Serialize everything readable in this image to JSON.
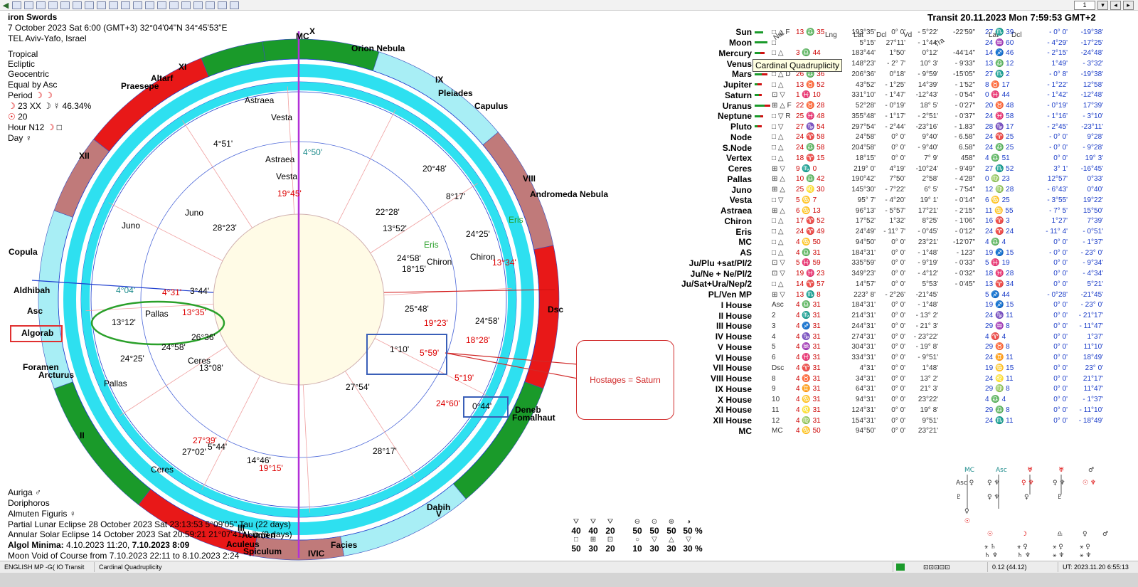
{
  "chart_header": {
    "name": "iron Swords",
    "date_line": "7 October 2023  Sat   6:00 (GMT+3) 32°04'04\"N  34°45'53\"E",
    "place": "TEL Aviv-Yafo, Israel",
    "settings": [
      "Tropical",
      "Ecliptic",
      "Geocentric",
      "Equal by Asc"
    ],
    "period": "Period",
    "period_line": "23 XX  ☽ ☿ 46.34%",
    "sun_line": "20",
    "hour": "Hour N12",
    "day": "Day"
  },
  "transit_header": "Transit 20.11.2023  Mon  7:59:53 GMT+2",
  "tooltip": "Cardinal Quadruplicity",
  "callout_text": "Hostages = Saturn",
  "fixed_stars_left": {
    "copula": "Copula",
    "aldhibah": "Aldhibah",
    "asc": "Asc",
    "algorab": "Algorab",
    "foramen": "Foramen",
    "arcturus": "Arcturus",
    "mc": "MC",
    "dsc": "Dsc",
    "ic": "IVIC"
  },
  "outer_stars": {
    "orion": "Orion Nebula",
    "pleiades": "Pleiades",
    "capulus": "Capulus",
    "andromeda": "Andromeda Nebula",
    "praesepe": "Praesepe",
    "altarf": "Altarf",
    "deneb": "Deneb",
    "fomalhaut": "Fomalhaut",
    "dabih": "Dabih",
    "facies": "Facies",
    "aculeus": "Aculeus",
    "acumen": "Acumen",
    "spiculum": "Spiculum"
  },
  "houses": [
    "XI",
    "XII",
    "IX",
    "VIII",
    "II",
    "III",
    "V",
    "X"
  ],
  "chart_labels": {
    "astraea_outer": "Astraea",
    "vesta_outer": "Vesta",
    "astraea_inner": "Astraea",
    "vesta_inner": "Vesta",
    "juno_outer": "Juno",
    "juno_inner": "Juno",
    "pallas_inner": "Pallas",
    "pallas_outer": "Pallas",
    "ceres_inner": "Ceres",
    "ceres_outer": "Ceres",
    "eris_outer": "Eris",
    "eris_inner": "Eris",
    "chiron_inner": "Chiron",
    "chiron_outer": "Chiron"
  },
  "chart_degrees": [
    {
      "key": "d1",
      "text": "4°51'",
      "color": "#000"
    },
    {
      "key": "d2",
      "text": "4°50'",
      "color": "#1a8a8a"
    },
    {
      "key": "d3",
      "text": "19°45'",
      "color": "#d00"
    },
    {
      "key": "d4",
      "text": "28°23'",
      "color": "#000"
    },
    {
      "key": "d5",
      "text": "20°48'",
      "color": "#000"
    },
    {
      "key": "d6",
      "text": "8°17'",
      "color": "#000"
    },
    {
      "key": "d7",
      "text": "22°28'",
      "color": "#000"
    },
    {
      "key": "d8",
      "text": "13°52'",
      "color": "#000"
    },
    {
      "key": "d9",
      "text": "24°25'",
      "color": "#000"
    },
    {
      "key": "d10",
      "text": "24°58'",
      "color": "#000"
    },
    {
      "key": "d11",
      "text": "18°15'",
      "color": "#000"
    },
    {
      "key": "d12",
      "text": "13°34'",
      "color": "#d00"
    },
    {
      "key": "d13",
      "text": "4°04'",
      "color": "#1a8a8a"
    },
    {
      "key": "d14",
      "text": "4°31'",
      "color": "#d00"
    },
    {
      "key": "d15",
      "text": "3°44'",
      "color": "#000"
    },
    {
      "key": "d16",
      "text": "13°35'",
      "color": "#d00"
    },
    {
      "key": "d17",
      "text": "13°12'",
      "color": "#000"
    },
    {
      "key": "d18",
      "text": "25°48'",
      "color": "#000"
    },
    {
      "key": "d19",
      "text": "19°23'",
      "color": "#d00"
    },
    {
      "key": "d20",
      "text": "24°58'",
      "color": "#000"
    },
    {
      "key": "d21",
      "text": "18°28'",
      "color": "#d00"
    },
    {
      "key": "d22",
      "text": "26°36'",
      "color": "#000"
    },
    {
      "key": "d23",
      "text": "24°58'",
      "color": "#000"
    },
    {
      "key": "d24",
      "text": "24°25'",
      "color": "#000"
    },
    {
      "key": "d25",
      "text": "1°10'",
      "color": "#000"
    },
    {
      "key": "d26",
      "text": "5°59'",
      "color": "#d00"
    },
    {
      "key": "d27",
      "text": "13°08'",
      "color": "#000"
    },
    {
      "key": "d28",
      "text": "5°19'",
      "color": "#d00"
    },
    {
      "key": "d29",
      "text": "27°54'",
      "color": "#000"
    },
    {
      "key": "d30",
      "text": "24°60'",
      "color": "#d00"
    },
    {
      "key": "d31",
      "text": "0°44'",
      "color": "#000"
    },
    {
      "key": "d32",
      "text": "27°39'",
      "color": "#d00"
    },
    {
      "key": "d33",
      "text": "27°02'",
      "color": "#000"
    },
    {
      "key": "d34",
      "text": "5°44'",
      "color": "#000"
    },
    {
      "key": "d35",
      "text": "14°46'",
      "color": "#000"
    },
    {
      "key": "d36",
      "text": "19°15'",
      "color": "#d00"
    },
    {
      "key": "d37",
      "text": "28°17'",
      "color": "#000"
    }
  ],
  "left_bottom": {
    "auriga": "Auriga",
    "doriphoros": "Doriphoros",
    "almuten": "Almuten Figuris",
    "eclipse1": "Partial Lunar Eclipse 28 October 2023 Sat 23:13:53  5°09'05\" Tau (22 days)",
    "eclipse2": "Annular Solar Eclipse 14 October 2023 Sat 20:59:21 21°07'41\" Lib (8 days)",
    "algol_label": "Algol Minima:",
    "algol_dates": "4.10.2023 11:20,",
    "algol_bold": "7.10.2023  8:09",
    "void": "Moon Void of Course from 7.10.2023 22:11 to 8.10.2023  2:24"
  },
  "table_headers": {
    "nat": "Nat",
    "lng": "Lng",
    "lat": "Lat",
    "dcl": "Dcl",
    "vd": "Vd",
    "tra": "Tra",
    "tlat": "Lat",
    "tdcl": "Dcl"
  },
  "planets": [
    {
      "name": "Sun",
      "asp": "□ △ F",
      "nat": "13 ♎ 35",
      "lng": "193°35'",
      "lat": "0° 0'",
      "dcl": "- 5°22'",
      "vd": "-22'59\"",
      "tra": "27 ♏ 39",
      "tlat": "- 0° 0'",
      "tdcl": "-19°38'"
    },
    {
      "name": "Moon",
      "asp": "□",
      "nat": "",
      "lng": "5°15'",
      "lat": "27°11'",
      "dcl": "- 1°44'",
      "vd": "",
      "tra": "24 ♒ 60",
      "tlat": "- 4°29'",
      "tdcl": "-17°25'"
    },
    {
      "name": "Mercury",
      "asp": "□ △",
      "nat": "3 ♎ 44",
      "lng": "183°44'",
      "lat": "1°50'",
      "dcl": "0°12'",
      "vd": "-44'14\"",
      "tra": "14 ♐ 46",
      "tlat": "- 2°15'",
      "tdcl": "-24°48'"
    },
    {
      "name": "Venus",
      "asp": "⊞ △",
      "nat": "28 ♌ 23",
      "lng": "148°23'",
      "lat": "- 2° 7'",
      "dcl": "10° 3'",
      "vd": "- 9'33\"",
      "tra": "13 ♎ 12",
      "tlat": "1°49'",
      "tdcl": "- 3°32'"
    },
    {
      "name": "Mars",
      "asp": "□ △ D",
      "nat": "26 ♎ 36",
      "lng": "206°36'",
      "lat": "0°18'",
      "dcl": "- 9°59'",
      "vd": "-15'05\"",
      "tra": "27 ♏ 2",
      "tlat": "- 0° 8'",
      "tdcl": "-19°38'"
    },
    {
      "name": "Jupiter",
      "asp": "□ △",
      "nat": "13 ♉ 52",
      "lng": "43°52'",
      "lat": "- 1°25'",
      "dcl": "14°39'",
      "vd": "- 1'52\"",
      "tra": "8 ♉ 17",
      "tlat": "- 1°22'",
      "tdcl": "12°58'"
    },
    {
      "name": "Saturn",
      "asp": "⊡ ▽",
      "nat": "1 ♓ 10",
      "lng": "331°10'",
      "lat": "- 1°47'",
      "dcl": "-12°43'",
      "vd": "- 0'54\"",
      "tra": "0 ♓ 44",
      "tlat": "- 1°42'",
      "tdcl": "-12°48'"
    },
    {
      "name": "Uranus",
      "asp": "⊞ △ F",
      "nat": "22 ♉ 28",
      "lng": "52°28'",
      "lat": "- 0°19'",
      "dcl": "18° 5'",
      "vd": "- 0'27\"",
      "tra": "20 ♉ 48",
      "tlat": "- 0°19'",
      "tdcl": "17°39'"
    },
    {
      "name": "Neptune",
      "asp": "□ ▽ R",
      "nat": "25 ♓ 48",
      "lng": "355°48'",
      "lat": "- 1°17'",
      "dcl": "- 2°51'",
      "vd": "- 0'37\"",
      "tra": "24 ♓ 58",
      "tlat": "- 1°16'",
      "tdcl": "- 3°10'"
    },
    {
      "name": "Pluto",
      "asp": "□ ▽",
      "nat": "27 ♑ 54",
      "lng": "297°54'",
      "lat": "- 2°44'",
      "dcl": "-23°16'",
      "vd": "- 1.83\"",
      "tra": "28 ♑ 17",
      "tlat": "- 2°45'",
      "tdcl": "-23°11'"
    },
    {
      "name": "Node",
      "asp": "□ △",
      "nat": "24 ♈ 58",
      "lng": "24°58'",
      "lat": "0° 0'",
      "dcl": "9°40'",
      "vd": "- 6.58\"",
      "tra": "24 ♈ 25",
      "tlat": "- 0° 0'",
      "tdcl": "9°28'"
    },
    {
      "name": "S.Node",
      "asp": "□ △",
      "nat": "24 ♎ 58",
      "lng": "204°58'",
      "lat": "0° 0'",
      "dcl": "- 9°40'",
      "vd": "6.58\"",
      "tra": "24 ♎ 25",
      "tlat": "- 0° 0'",
      "tdcl": "- 9°28'"
    },
    {
      "name": "Vertex",
      "asp": "□ △",
      "nat": "18 ♈ 15",
      "lng": "18°15'",
      "lat": "0° 0'",
      "dcl": "7° 9'",
      "vd": "458\"",
      "tra": "4 ♎ 51",
      "tlat": "0° 0'",
      "tdcl": "19° 3'"
    },
    {
      "name": "Ceres",
      "asp": "⊞ ▽",
      "nat": "9 ♏ 0",
      "lng": "219° 0'",
      "lat": "4°19'",
      "dcl": "-10°24'",
      "vd": "- 9'49\"",
      "tra": "27 ♏ 52",
      "tlat": "3° 1'",
      "tdcl": "-16°45'"
    },
    {
      "name": "Pallas",
      "asp": "⊞ △",
      "nat": "10 ♎ 42",
      "lng": "190°42'",
      "lat": "7°50'",
      "dcl": "2°58'",
      "vd": "- 4'28\"",
      "tra": "0 ♍ 23",
      "tlat": "12°57'",
      "tdcl": "0°33'"
    },
    {
      "name": "Juno",
      "asp": "⊞ △",
      "nat": "25 ♌ 30",
      "lng": "145°30'",
      "lat": "- 7°22'",
      "dcl": "6° 5'",
      "vd": "- 7'54\"",
      "tra": "12 ♍ 28",
      "tlat": "- 6°43'",
      "tdcl": "0°40'"
    },
    {
      "name": "Vesta",
      "asp": "□ ▽",
      "nat": "5 ♋ 7",
      "lng": "95° 7'",
      "lat": "- 4°20'",
      "dcl": "19° 1'",
      "vd": "- 0'14\"",
      "tra": "6 ♋ 25",
      "tlat": "- 3°55'",
      "tdcl": "19°22'"
    },
    {
      "name": "Astraea",
      "asp": "⊞ △",
      "nat": "6 ♋ 13",
      "lng": "96°13'",
      "lat": "- 5°57'",
      "dcl": "17°21'",
      "vd": "- 2'15\"",
      "tra": "11 ♋ 55",
      "tlat": "- 7° 5'",
      "tdcl": "15°50'"
    },
    {
      "name": "Chiron",
      "asp": "□ △",
      "nat": "17 ♈ 52",
      "lng": "17°52'",
      "lat": "1°32'",
      "dcl": "8°25'",
      "vd": "- 1'06\"",
      "tra": "16 ♈ 3",
      "tlat": "1°27'",
      "tdcl": "7°39'"
    },
    {
      "name": "Eris",
      "asp": "□ △",
      "nat": "24 ♈ 49",
      "lng": "24°49'",
      "lat": "- 11° 7'",
      "dcl": "- 0°45'",
      "vd": "- 0'12\"",
      "tra": "24 ♈ 24",
      "tlat": "- 11° 4'",
      "tdcl": "- 0°51'"
    },
    {
      "name": "MC",
      "asp": "□ △",
      "nat": "4 ♋ 50",
      "lng": "94°50'",
      "lat": "0° 0'",
      "dcl": "23°21'",
      "vd": "-12'07\"",
      "tra": "4 ♎ 4",
      "tlat": "0° 0'",
      "tdcl": "- 1°37'"
    },
    {
      "name": "AS",
      "asp": "□ △",
      "nat": "4 ♎ 31",
      "lng": "184°31'",
      "lat": "0° 0'",
      "dcl": "- 1°48'",
      "vd": "- 123\"",
      "tra": "19 ♐ 15",
      "tlat": "- 0° 0'",
      "tdcl": "- 23° 0'"
    },
    {
      "name": "Ju/Plu +sat/Pl/2",
      "asp": "⊡ ▽",
      "nat": "5 ♓ 59",
      "lng": "335°59'",
      "lat": "0° 0'",
      "dcl": "- 9°19'",
      "vd": "- 0'33\"",
      "tra": "5 ♓ 19",
      "tlat": "0° 0'",
      "tdcl": "- 9°34'"
    },
    {
      "name": "Ju/Ne + Ne/Pl/2",
      "asp": "⊡ ▽",
      "nat": "19 ♓ 23",
      "lng": "349°23'",
      "lat": "0° 0'",
      "dcl": "- 4°12'",
      "vd": "- 0'32\"",
      "tra": "18 ♓ 28",
      "tlat": "0° 0'",
      "tdcl": "- 4°34'"
    },
    {
      "name": "Ju/Sat+Ura/Nep/2",
      "asp": "□ △",
      "nat": "14 ♈ 57",
      "lng": "14°57'",
      "lat": "0° 0'",
      "dcl": "5°53'",
      "vd": "- 0'45\"",
      "tra": "13 ♈ 34",
      "tlat": "0° 0'",
      "tdcl": "5°21'"
    },
    {
      "name": "PL/Ven MP",
      "asp": "⊞ ▽",
      "nat": "13 ♏ 8",
      "lng": "223° 8'",
      "lat": "- 2°26'",
      "dcl": "-21°45'",
      "vd": "",
      "tra": "5 ♐ 44",
      "tlat": "- 0°28'",
      "tdcl": "-21°45'"
    },
    {
      "name": "I House",
      "asp": "Asc",
      "nat": "4 ♎ 31",
      "lng": "184°31'",
      "lat": "0° 0'",
      "dcl": "- 1°48'",
      "vd": "",
      "tra": "19 ♐ 15",
      "tlat": "0° 0'",
      "tdcl": "- 23° 0'"
    },
    {
      "name": "II House",
      "asp": "2",
      "nat": "4 ♏ 31",
      "lng": "214°31'",
      "lat": "0° 0'",
      "dcl": "- 13° 2'",
      "vd": "",
      "tra": "24 ♑ 11",
      "tlat": "0° 0'",
      "tdcl": "- 21°17'"
    },
    {
      "name": "III House",
      "asp": "3",
      "nat": "4 ♐ 31",
      "lng": "244°31'",
      "lat": "0° 0'",
      "dcl": "- 21° 3'",
      "vd": "",
      "tra": "29 ♒ 8",
      "tlat": "0° 0'",
      "tdcl": "- 11°47'"
    },
    {
      "name": "IV House",
      "asp": "4",
      "nat": "4 ♑ 31",
      "lng": "274°31'",
      "lat": "0° 0'",
      "dcl": "- 23°22'",
      "vd": "",
      "tra": "4 ♈ 4",
      "tlat": "0° 0'",
      "tdcl": "1°37'"
    },
    {
      "name": "V House",
      "asp": "5",
      "nat": "4 ♒ 31",
      "lng": "304°31'",
      "lat": "0° 0'",
      "dcl": "- 19° 8'",
      "vd": "",
      "tra": "29 ♉ 8",
      "tlat": "0° 0'",
      "tdcl": "11°10'"
    },
    {
      "name": "VI House",
      "asp": "6",
      "nat": "4 ♓ 31",
      "lng": "334°31'",
      "lat": "0° 0'",
      "dcl": "- 9°51'",
      "vd": "",
      "tra": "24 ♊ 11",
      "tlat": "0° 0'",
      "tdcl": "18°49'"
    },
    {
      "name": "VII House",
      "asp": "Dsc",
      "nat": "4 ♈ 31",
      "lng": "4°31'",
      "lat": "0° 0'",
      "dcl": "1°48'",
      "vd": "",
      "tra": "19 ♋ 15",
      "tlat": "0° 0'",
      "tdcl": "23° 0'"
    },
    {
      "name": "VIII House",
      "asp": "8",
      "nat": "4 ♉ 31",
      "lng": "34°31'",
      "lat": "0° 0'",
      "dcl": "13° 2'",
      "vd": "",
      "tra": "24 ♌ 11",
      "tlat": "0° 0'",
      "tdcl": "21°17'"
    },
    {
      "name": "IX House",
      "asp": "9",
      "nat": "4 ♊ 31",
      "lng": "64°31'",
      "lat": "0° 0'",
      "dcl": "21° 3'",
      "vd": "",
      "tra": "29 ♍ 8",
      "tlat": "0° 0'",
      "tdcl": "11°47'"
    },
    {
      "name": "X House",
      "asp": "10",
      "nat": "4 ♋ 31",
      "lng": "94°31'",
      "lat": "0° 0'",
      "dcl": "23°22'",
      "vd": "",
      "tra": "4 ♎ 4",
      "tlat": "0° 0'",
      "tdcl": "- 1°37'"
    },
    {
      "name": "XI House",
      "asp": "11",
      "nat": "4 ♌ 31",
      "lng": "124°31'",
      "lat": "0° 0'",
      "dcl": "19° 8'",
      "vd": "",
      "tra": "29 ♎ 8",
      "tlat": "0° 0'",
      "tdcl": "- 11°10'"
    },
    {
      "name": "XII House",
      "asp": "12",
      "nat": "4 ♍ 31",
      "lng": "154°31'",
      "lat": "0° 0'",
      "dcl": "9°51'",
      "vd": "",
      "tra": "24 ♏ 11",
      "tlat": "0° 0'",
      "tdcl": "- 18°49'"
    },
    {
      "name": "MC",
      "asp": "MC",
      "nat": "4 ♋ 50",
      "lng": "94°50'",
      "lat": "0° 0'",
      "dcl": "23°21'",
      "vd": "",
      "tra": "",
      "tlat": "",
      "tdcl": ""
    }
  ],
  "elements": {
    "row1": [
      "40",
      "40",
      "20"
    ],
    "row2": [
      "50",
      "30",
      "20"
    ],
    "row3": [
      "50",
      "50",
      "50",
      "50 %"
    ],
    "row4": [
      "10",
      "30",
      "30",
      "30 %"
    ]
  },
  "statusbar": {
    "seg1": "ENGLISH MP -G( IO Transit",
    "seg2": "Cardinal Quadruplicity",
    "coords": "0.12 (44.12)",
    "ut": "UT: 2023.11.20  6:55:13"
  },
  "toolbar_page": "1"
}
